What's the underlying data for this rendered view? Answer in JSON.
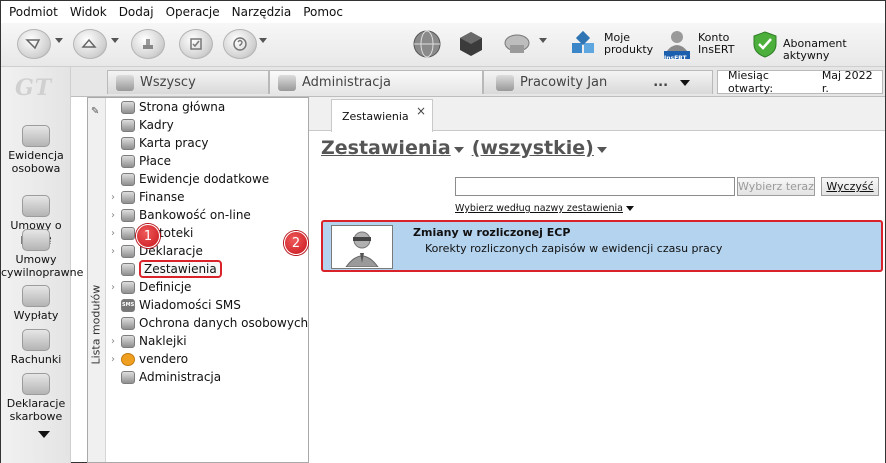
{
  "menu": [
    "Podmiot",
    "Widok",
    "Dodaj",
    "Operacje",
    "Narzędzia",
    "Pomoc"
  ],
  "toolbar": {
    "my_products_line1": "Moje",
    "my_products_line2": "produkty",
    "insert_account_line1": "Konto",
    "insert_account_line2": "InsERT",
    "insert_badge": "InsERT",
    "subscription": "Abonament aktywny"
  },
  "logo": "GT",
  "leftnav": [
    {
      "label": "Ewidencja osobowa",
      "icon": "person-card-icon"
    },
    {
      "label": "Umowy o pracę",
      "icon": "contract-icon"
    },
    {
      "label": "Umowy cywilnoprawne",
      "icon": "civil-contract-icon"
    },
    {
      "label": "Wypłaty",
      "icon": "payout-icon"
    },
    {
      "label": "Rachunki",
      "icon": "bill-icon"
    },
    {
      "label": "Deklaracje skarbowe",
      "icon": "tax-declaration-icon"
    }
  ],
  "tabs": {
    "all": "Wszyscy",
    "administration": "Administracja",
    "employee": "Pracowity Jan",
    "more": "...",
    "month_label": "Miesiąc otwarty:",
    "month_value": "Maj 2022 r."
  },
  "module_panel": {
    "title": "Lista modułów",
    "items": [
      {
        "label": "Strona główna",
        "expandable": false
      },
      {
        "label": "Kadry",
        "expandable": false
      },
      {
        "label": "Karta pracy",
        "expandable": false
      },
      {
        "label": "Płace",
        "expandable": false
      },
      {
        "label": "Ewidencje dodatkowe",
        "expandable": false
      },
      {
        "label": "Finanse",
        "expandable": true
      },
      {
        "label": "Bankowość on-line",
        "expandable": true
      },
      {
        "label": "Kartoteki",
        "expandable": true
      },
      {
        "label": "Deklaracje",
        "expandable": true
      },
      {
        "label": "Zestawienia",
        "expandable": false
      },
      {
        "label": "Definicje",
        "expandable": true
      },
      {
        "label": "Wiadomości SMS",
        "expandable": false
      },
      {
        "label": "Ochrona danych osobowych",
        "expandable": false
      },
      {
        "label": "Naklejki",
        "expandable": true
      },
      {
        "label": "vendero",
        "expandable": true
      },
      {
        "label": "Administracja",
        "expandable": false
      }
    ],
    "sms_icon_text": "SMS"
  },
  "badges": [
    "1",
    "2"
  ],
  "main": {
    "tab_label": "Zestawienia",
    "tab_close": "×",
    "heading": "Zestawienia",
    "filter": "(wszystkie)",
    "search_value": "",
    "search_button": "Wybierz teraz",
    "clear_button": "Wyczyść",
    "choose_link": "Wybierz według nazwy zestawienia",
    "report": {
      "title": "Zmiany w rozliczonej ECP",
      "description": "Korekty rozliczonych zapisów w ewidencji czasu pracy"
    }
  }
}
